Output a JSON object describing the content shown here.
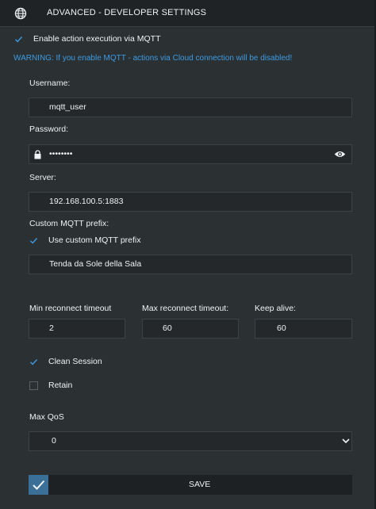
{
  "header": {
    "title": "ADVANCED - DEVELOPER SETTINGS",
    "icon": "globe-icon"
  },
  "mqtt": {
    "enable_label": "Enable action execution via MQTT",
    "enable_checked": true,
    "warning": "WARNING: If you enable MQTT - actions via Cloud connection will be disabled!"
  },
  "fields": {
    "username_label": "Username:",
    "username_value": "mqtt_user",
    "password_label": "Password:",
    "password_value": "••••••••",
    "server_label": "Server:",
    "server_value": "192.168.100.5:1883",
    "prefix_label": "Custom MQTT prefix:",
    "use_prefix_label": "Use custom MQTT prefix",
    "use_prefix_checked": true,
    "prefix_value": "Tenda da Sole della Sala"
  },
  "timeouts": {
    "min_label": "Min reconnect timeout",
    "min_value": "2",
    "max_label": "Max reconnect timeout:",
    "max_value": "60",
    "keepalive_label": "Keep alive:",
    "keepalive_value": "60"
  },
  "options": {
    "clean_session_label": "Clean Session",
    "clean_session_checked": true,
    "retain_label": "Retain",
    "retain_checked": false
  },
  "qos": {
    "label": "Max QoS",
    "selected": "0"
  },
  "save": {
    "label": "SAVE"
  },
  "colors": {
    "accent": "#3d9be2",
    "check": "#3d9be2",
    "save_check_bg": "#3a6f97"
  }
}
